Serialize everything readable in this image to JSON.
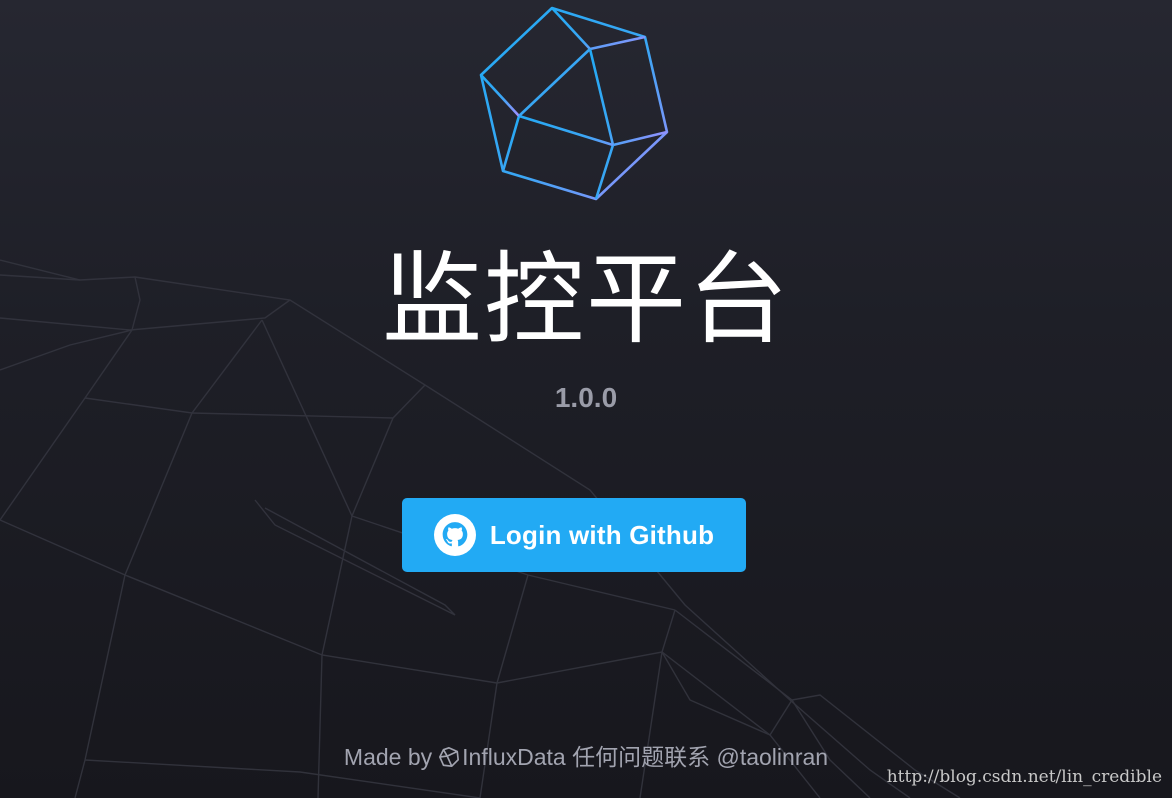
{
  "app": {
    "title": "监控平台",
    "version": "1.0.0"
  },
  "login": {
    "label": "Login with Github",
    "icon": "github-icon",
    "color": "#22aaf4"
  },
  "footer": {
    "prefix": "Made by",
    "brand": "InfluxData",
    "brand_icon": "influxdata-icon",
    "contact": "任何问题联系 @taolinran"
  },
  "watermark": {
    "text": "http://blog.csdn.net/lin_credible"
  },
  "colors": {
    "background": "#1e1f27",
    "logo_gradient_start": "#22aaf4",
    "logo_gradient_end": "#9b8cff",
    "version_text": "#9a9ca8",
    "footer_text": "#a2a4b0"
  }
}
